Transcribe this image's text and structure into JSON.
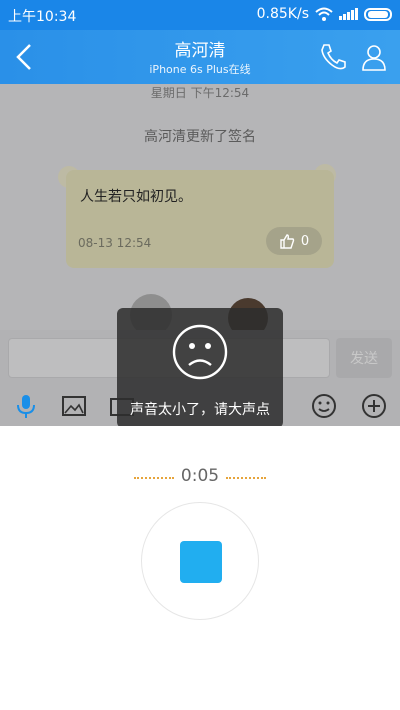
{
  "status_bar": {
    "time": "上午10:34",
    "network_speed": "0.85K/s"
  },
  "header": {
    "title": "高河清",
    "subtitle": "iPhone 6s Plus在线"
  },
  "chat": {
    "timestamp": "星期日 下午12:54",
    "system_message": "高河清更新了签名",
    "signature_card": {
      "text": "人生若只如初见。",
      "time": "08-13 12:54",
      "likes": "0"
    }
  },
  "input": {
    "send_label": "发送"
  },
  "toast": {
    "message": "声音太小了，请大声点"
  },
  "recorder": {
    "elapsed": "0:05"
  },
  "colors": {
    "header": "#2a90e8",
    "record_accent": "#21aef0",
    "dots": "#e6a43b"
  }
}
